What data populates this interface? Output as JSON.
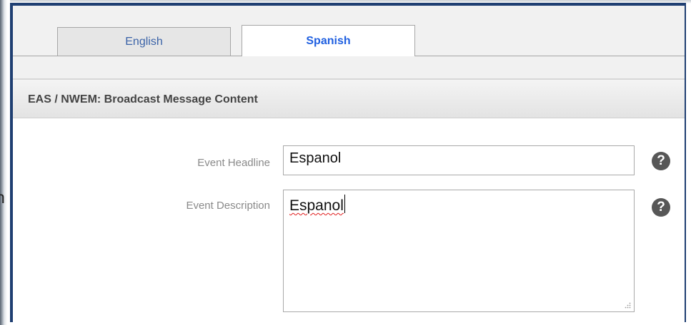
{
  "tabs": [
    {
      "label": "English",
      "selected": false
    },
    {
      "label": "Spanish",
      "selected": true
    }
  ],
  "section": {
    "title": "EAS / NWEM: Broadcast Message Content"
  },
  "form": {
    "headline_label": "Event Headline",
    "headline_value": "Espanol",
    "description_label": "Event Description",
    "description_value": "Espanol"
  },
  "help_icon": {
    "name": "question-circle-icon",
    "glyph": "?"
  },
  "clipped_background_text": "n",
  "colors": {
    "frame_border": "#1f3f72",
    "active_tab_text": "#1f5fe0",
    "inactive_tab_text": "#3b63a8",
    "help_icon_bg": "#575757"
  }
}
